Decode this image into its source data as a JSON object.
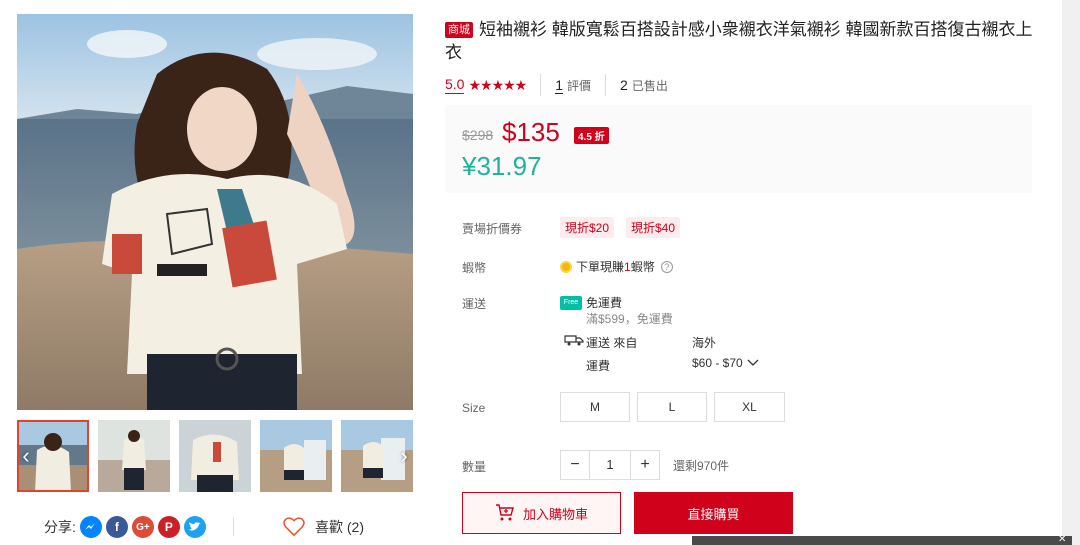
{
  "title": "短袖襯衫 韓版寬鬆百搭設計感小衆襯衣洋氣襯衫 韓國新款百搭復古襯衣上衣",
  "shop_badge": "商城",
  "rating": {
    "score": "5.0",
    "stars": "★★★★★",
    "reviews_count": "1",
    "reviews_label": "評價",
    "sold_count": "2",
    "sold_label": "已售出"
  },
  "price": {
    "original": "$298",
    "current": "$135",
    "discount": "4.5 折",
    "cny": "¥31.97"
  },
  "voucher": {
    "label": "賣場折價券",
    "items": [
      "現折$20",
      "現折$40"
    ]
  },
  "coins": {
    "label": "蝦幣",
    "text_before": "下單現賺",
    "amount": "1",
    "text_after": "蝦幣"
  },
  "shipping": {
    "label": "運送",
    "free_badge": "Free",
    "free_title": "免運費",
    "free_sub": "滿$599，免運費",
    "from_label": "運送 來自",
    "from_value": "海外",
    "fee_label": "運費",
    "fee_value": "$60 - $70"
  },
  "size": {
    "label": "Size",
    "options": [
      "M",
      "L",
      "XL"
    ]
  },
  "quantity": {
    "label": "數量",
    "value": "1",
    "stock_text": "還剩970件"
  },
  "actions": {
    "add_to_cart": "加入購物車",
    "buy_now": "直接購買"
  },
  "share": {
    "label": "分享:"
  },
  "like": {
    "label": "喜歡 (2)"
  },
  "colors": {
    "accent": "#d0011b",
    "teal": "#1fb39b"
  }
}
